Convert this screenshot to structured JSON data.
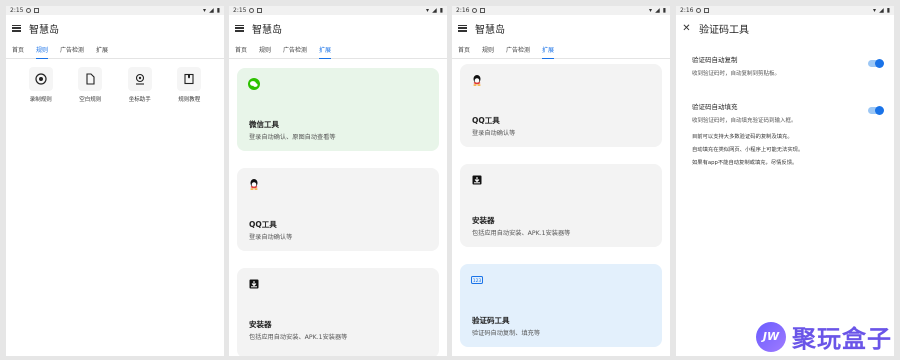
{
  "app_title": "智慧岛",
  "tabs": [
    "首页",
    "规则",
    "广告检测",
    "扩展"
  ],
  "screen1": {
    "time": "2:15",
    "rules": [
      {
        "label": "录制规则",
        "icon": "record-icon"
      },
      {
        "label": "空白规则",
        "icon": "blank-file-icon"
      },
      {
        "label": "坐标助手",
        "icon": "location-icon"
      },
      {
        "label": "规则教程",
        "icon": "bookmark-icon"
      }
    ]
  },
  "screen2": {
    "time": "2:15",
    "cards": [
      {
        "title": "微信工具",
        "desc": "登录自动确认、原图自动查看等",
        "icon": "wechat-icon",
        "color": "#e8f5e9"
      },
      {
        "title": "QQ工具",
        "desc": "登录自动确认等",
        "icon": "qq-icon",
        "color": "#f3f3f3"
      },
      {
        "title": "安装器",
        "desc": "包括应用自动安装、APK.1安装器等",
        "icon": "installer-icon",
        "color": "#f3f3f3"
      }
    ]
  },
  "screen3": {
    "time": "2:16",
    "cards": [
      {
        "title": "QQ工具",
        "desc": "登录自动确认等",
        "icon": "qq-icon",
        "color": "#f3f3f3"
      },
      {
        "title": "安装器",
        "desc": "包括应用自动安装、APK.1安装器等",
        "icon": "installer-icon",
        "color": "#f3f3f3"
      },
      {
        "title": "验证码工具",
        "desc": "验证码自动复制、填充等",
        "icon": "verification-code-icon",
        "color": "#e3f0fc"
      }
    ]
  },
  "screen4": {
    "time": "2:16",
    "title": "验证码工具",
    "settings": [
      {
        "title": "验证码自动复制",
        "desc": "收到验证码时，自动复制到剪贴板。",
        "enabled": true
      },
      {
        "title": "验证码自动填充",
        "desc": "收到验证码时，自动填充验证码到输入框。",
        "enabled": true
      }
    ],
    "notes": [
      "目前可以支持大多数验证码的复制及填充。",
      "自动填充在类似网页、小程序上可能无法实现。",
      "如果有app不能自动复制或填充，尽情反馈。"
    ]
  },
  "watermark": {
    "badge": "JW",
    "text": "聚玩盒子"
  },
  "colors": {
    "accent": "#1a73e8",
    "green_card": "#e8f5e9",
    "blue_card": "#e3f0fc",
    "gray_card": "#f3f3f3"
  }
}
